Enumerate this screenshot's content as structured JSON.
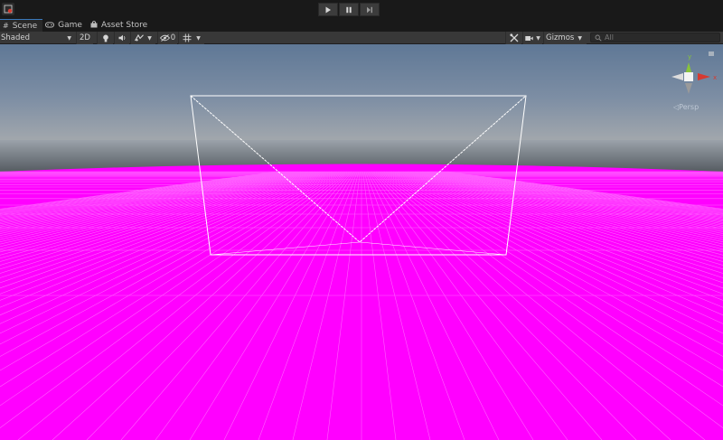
{
  "toolbar_top": {
    "collab_icon": "collab-icon",
    "play_icon": "play-icon",
    "pause_icon": "pause-icon",
    "step_icon": "step-icon"
  },
  "tabs": [
    {
      "label": "Scene",
      "icon": "grid-icon",
      "active": true
    },
    {
      "label": "Game",
      "icon": "gamepad-icon",
      "active": false
    },
    {
      "label": "Asset Store",
      "icon": "bag-icon",
      "active": false
    }
  ],
  "scene_toolbar": {
    "draw_mode": "Shaded",
    "mode_2d": "2D",
    "hidden_count": "0",
    "gizmos_label": "Gizmos",
    "search_placeholder": "All"
  },
  "scene_view": {
    "projection_label": "◁Persp",
    "ground_color": "#ff00ff",
    "sky_top_color": "#5f7896",
    "sky_horizon_color": "#9ea4ad",
    "gizmo_axis_colors": {
      "y": "#88c43a",
      "x": "#d63a30",
      "z": "#8a8a8a"
    }
  }
}
